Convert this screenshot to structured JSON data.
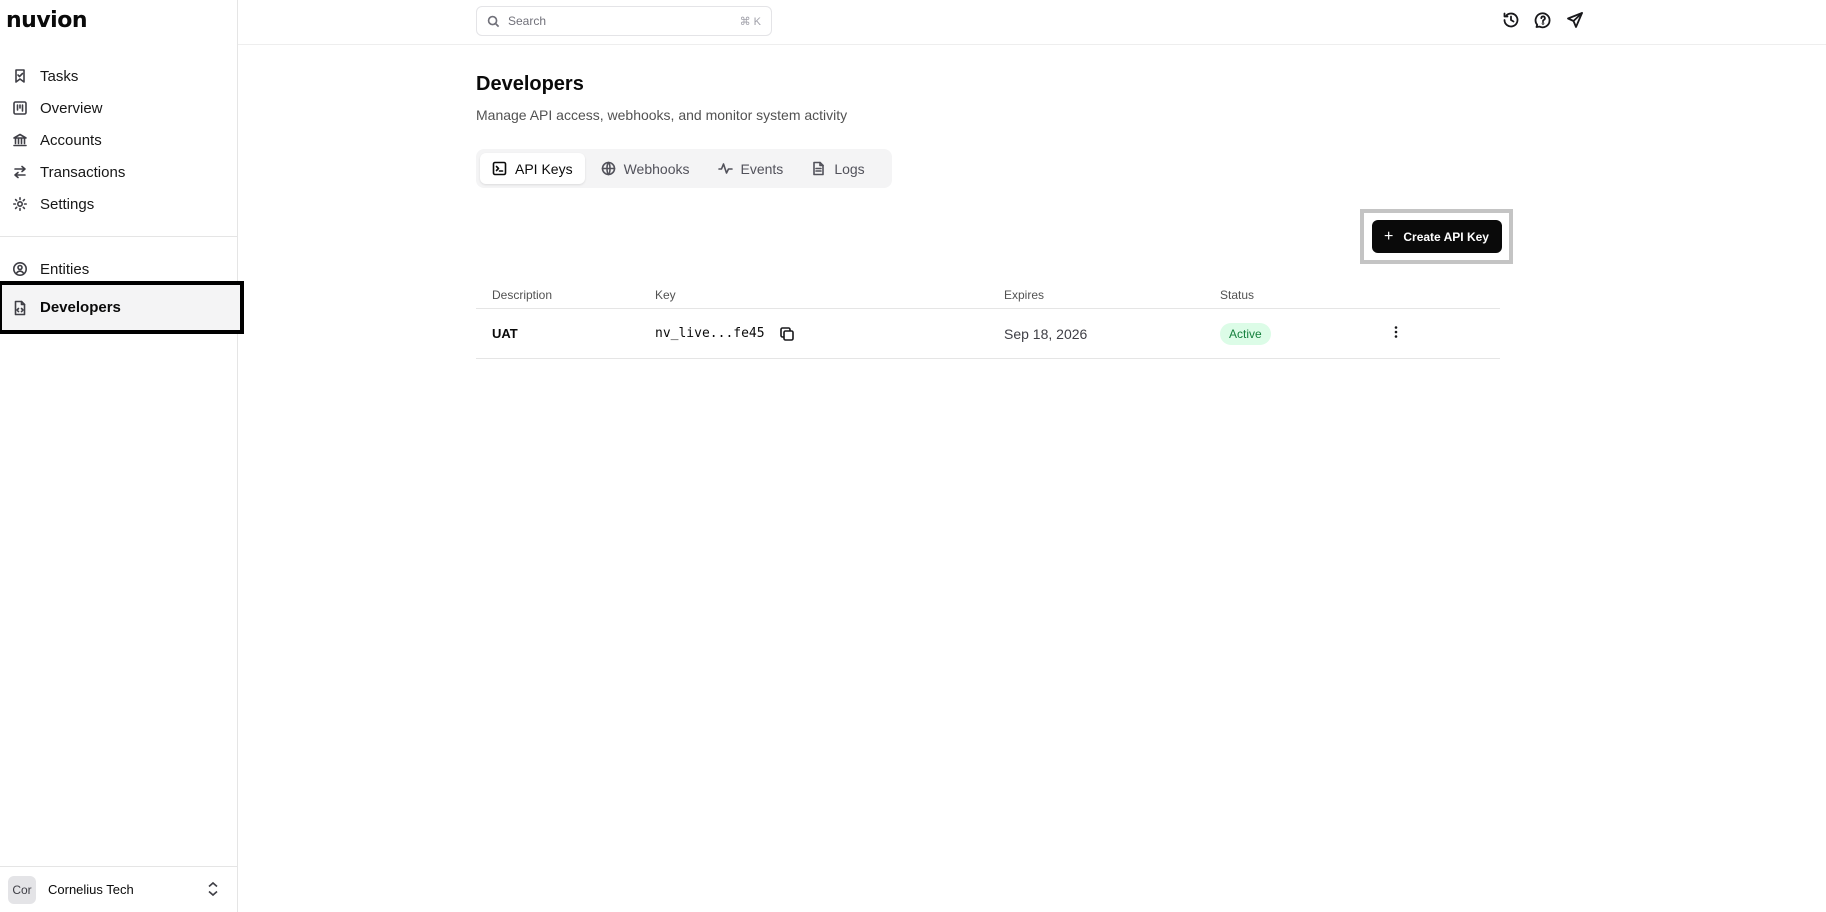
{
  "brand": {
    "logo": "nuvion"
  },
  "sidebar": {
    "items": [
      {
        "label": "Tasks",
        "icon": "bookmark-check-icon"
      },
      {
        "label": "Overview",
        "icon": "kanban-icon"
      },
      {
        "label": "Accounts",
        "icon": "bank-icon"
      },
      {
        "label": "Transactions",
        "icon": "arrows-left-right-icon"
      },
      {
        "label": "Settings",
        "icon": "gear-icon"
      }
    ],
    "items2": [
      {
        "label": "Entities",
        "icon": "user-circle-icon"
      },
      {
        "label": "Developers",
        "icon": "file-code-icon",
        "active": true
      }
    ],
    "org": {
      "avatar": "Cor",
      "name": "Cornelius Tech"
    }
  },
  "topbar": {
    "search": {
      "placeholder": "Search",
      "shortcut": "⌘ K"
    }
  },
  "page": {
    "title": "Developers",
    "subtitle": "Manage API access, webhooks, and monitor system activity"
  },
  "tabs": [
    {
      "label": "API Keys",
      "active": true
    },
    {
      "label": "Webhooks"
    },
    {
      "label": "Events"
    },
    {
      "label": "Logs"
    }
  ],
  "actions": {
    "create_label": "Create API Key"
  },
  "table": {
    "headers": [
      "Description",
      "Key",
      "Expires",
      "Status"
    ],
    "rows": [
      {
        "description": "UAT",
        "key": "nv_live...fe45",
        "expires": "Sep 18, 2026",
        "status": "Active"
      }
    ]
  },
  "colors": {
    "accent": "#0a0a0a",
    "status_active_bg": "#dcfce7",
    "status_active_fg": "#15803d"
  }
}
